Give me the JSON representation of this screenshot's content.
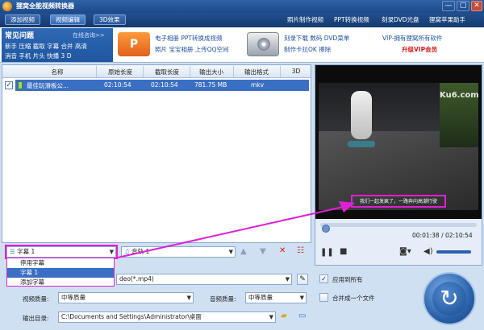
{
  "window": {
    "title": "狸窝全能视频转换器",
    "min": "—",
    "max": "▢",
    "close": "✕"
  },
  "toolbar": {
    "add_video": "添加视频",
    "video_edit": "视频编辑",
    "effects_3d": "3D效果",
    "links": [
      "照片制作视频",
      "PPT转换视频",
      "刻录DVD光盘",
      "狸窝苹果助手"
    ]
  },
  "faq": {
    "heading": "常见问题",
    "online": "在线咨询>>",
    "line1": "新手 压缩 截取 字幕 合并 高清",
    "line2": "消音 手机 片头 快播 3 D"
  },
  "promo": {
    "block1_line1": "电子相册 PPT转换成视频",
    "block1_line2": "照片 宝宝相册 上传QQ空间",
    "block2_line1": "刻录下载 数码 DVD菜单",
    "block2_line2": "制作卡拉OK 擦除",
    "vip_line1": "VIP-拥有狸窝所有软件",
    "vip_line2": "升级VIP会员"
  },
  "filelist": {
    "columns": [
      "名称",
      "原始长度",
      "截取长度",
      "输出大小",
      "输出格式",
      "3D"
    ],
    "rows": [
      {
        "checked": true,
        "name": "最佳玩滑板公...",
        "original_length": "02:10:54",
        "cut_length": "02:10:54",
        "output_size": "781.75 MB",
        "output_format": "mkv",
        "three_d": ""
      }
    ]
  },
  "player": {
    "watermark": "Ku6.com",
    "subtitle": "我们一起发疯了，一路奔向高潮行驶",
    "time": "00:01:38 / 02:10:54",
    "progress": 0.0125,
    "volume": 0.85
  },
  "subtitle_combo": {
    "selected": "字幕 1",
    "options": [
      "停用字幕",
      "字幕 1",
      "添加字幕"
    ],
    "selected_index": 1
  },
  "audio_combo": {
    "selected": "音轨 1"
  },
  "output": {
    "profile_value": "deo(*.mp4)",
    "apply_all_label": "应用到所有",
    "apply_all_checked": true,
    "merge_label": "合并成一个文件",
    "merge_checked": false,
    "video_quality_label": "视频质量:",
    "video_quality_value": "中等质量",
    "audio_quality_label": "音频质量:",
    "audio_quality_value": "中等质量",
    "dir_label": "输出目录:",
    "dir_value": "C:\\Documents and Settings\\Administrator\\桌面"
  },
  "colors": {
    "accent": "#3a6fc4",
    "highlight": "#e020d4",
    "vip_red": "#d21b1b"
  }
}
